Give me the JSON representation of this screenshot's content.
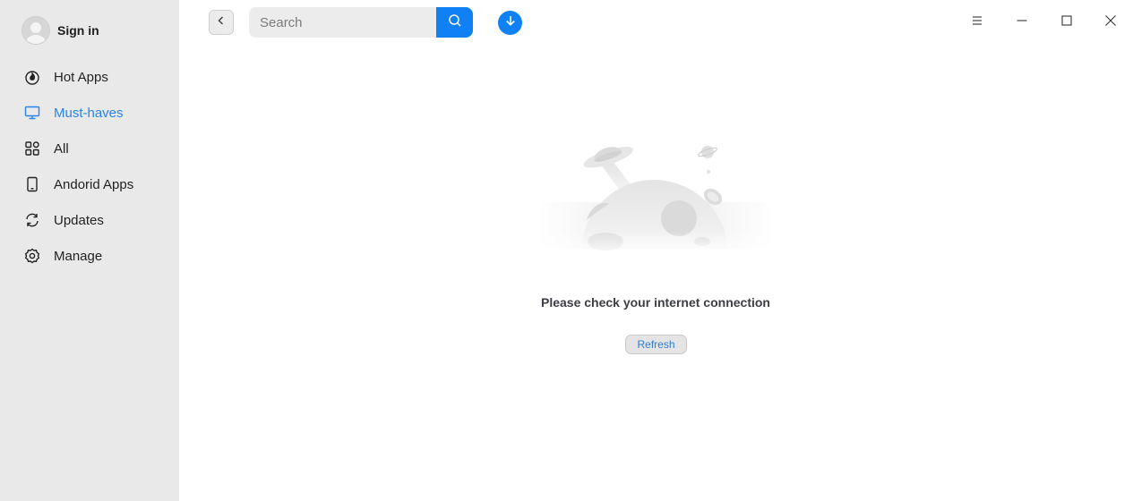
{
  "sidebar": {
    "signin_label": "Sign in",
    "items": [
      {
        "label": "Hot Apps",
        "icon": "fire-icon",
        "active": false
      },
      {
        "label": "Must-haves",
        "icon": "monitor-icon",
        "active": true
      },
      {
        "label": "All",
        "icon": "grid-icon",
        "active": false
      },
      {
        "label": "Andorid Apps",
        "icon": "phone-icon",
        "active": false
      },
      {
        "label": "Updates",
        "icon": "refresh-icon",
        "active": false
      },
      {
        "label": "Manage",
        "icon": "gear-icon",
        "active": false
      }
    ]
  },
  "toolbar": {
    "search_placeholder": "Search"
  },
  "main": {
    "message": "Please check your internet connection",
    "refresh_label": "Refresh"
  },
  "colors": {
    "accent": "#0f81f5",
    "active_text": "#2a83e8",
    "sidebar_bg": "#e9e9e9"
  }
}
